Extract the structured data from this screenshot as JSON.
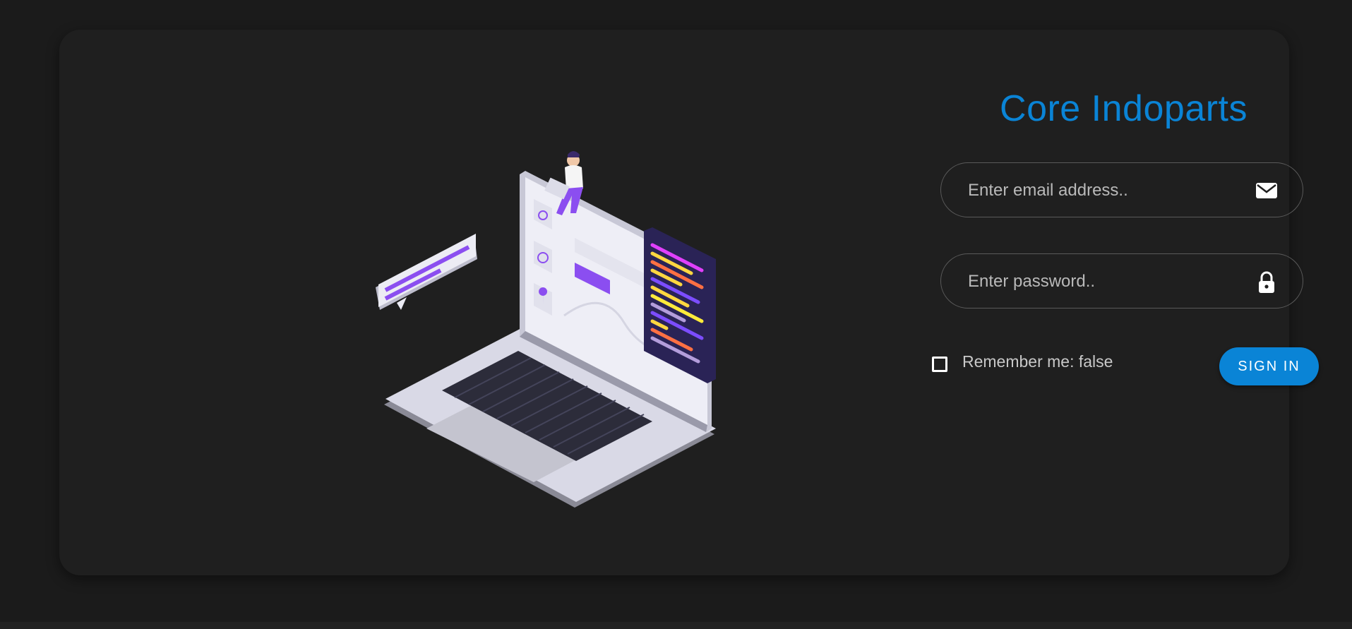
{
  "app": {
    "title": "Core Indoparts"
  },
  "form": {
    "email": {
      "placeholder": "Enter email address..",
      "value": "",
      "icon": "envelope-icon"
    },
    "password": {
      "placeholder": "Enter password..",
      "value": "",
      "icon": "lock-icon"
    },
    "remember": {
      "label": "Remember me: false",
      "checked": false
    },
    "submit_label": "SIGN IN"
  },
  "theme": {
    "accent": "#0a84d6",
    "background": "#1b1b1b",
    "card": "#1f1f1f",
    "illustration_purple": "#8b4ef0"
  }
}
